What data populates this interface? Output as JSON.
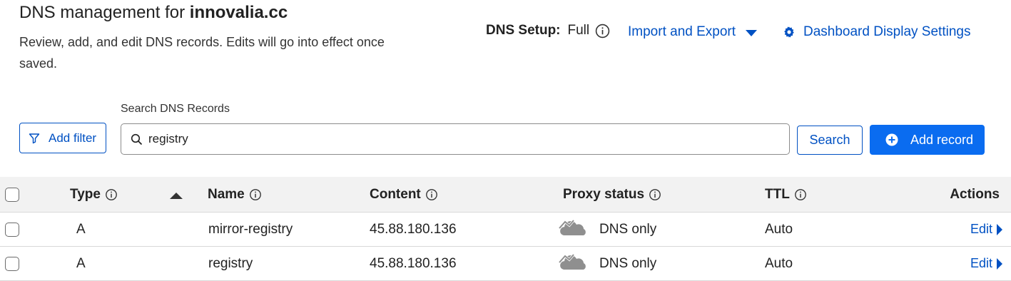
{
  "header": {
    "title_prefix": "DNS management for ",
    "domain": "innovalia.cc",
    "subtitle": "Review, add, and edit DNS records. Edits will go into effect once saved."
  },
  "setup": {
    "label": "DNS Setup:",
    "value": "Full"
  },
  "links": {
    "import_export": "Import and Export",
    "dashboard_settings": "Dashboard Display Settings"
  },
  "toolbar": {
    "add_filter": "Add filter",
    "search_label": "Search DNS Records",
    "search_value": "registry",
    "search_button": "Search",
    "add_record": "Add record"
  },
  "table": {
    "columns": {
      "type": "Type",
      "name": "Name",
      "content": "Content",
      "proxy": "Proxy status",
      "ttl": "TTL",
      "actions": "Actions"
    },
    "rows": [
      {
        "type": "A",
        "name": "mirror-registry",
        "content": "45.88.180.136",
        "proxy": "DNS only",
        "ttl": "Auto",
        "action": "Edit"
      },
      {
        "type": "A",
        "name": "registry",
        "content": "45.88.180.136",
        "proxy": "DNS only",
        "ttl": "Auto",
        "action": "Edit"
      }
    ]
  },
  "colors": {
    "link": "#0051c3",
    "primary_button": "#0a6cf0",
    "header_bg": "#f2f2f2",
    "cloud_grey": "#8f8f8f"
  },
  "icons": {
    "info": "info-icon",
    "caret": "caret-down-icon",
    "gear": "gear-icon",
    "filter": "filter-icon",
    "search": "search-icon",
    "plus": "plus-circle-icon",
    "cloud": "cloud-dns-only-icon",
    "sort": "sort-ascending-icon"
  }
}
